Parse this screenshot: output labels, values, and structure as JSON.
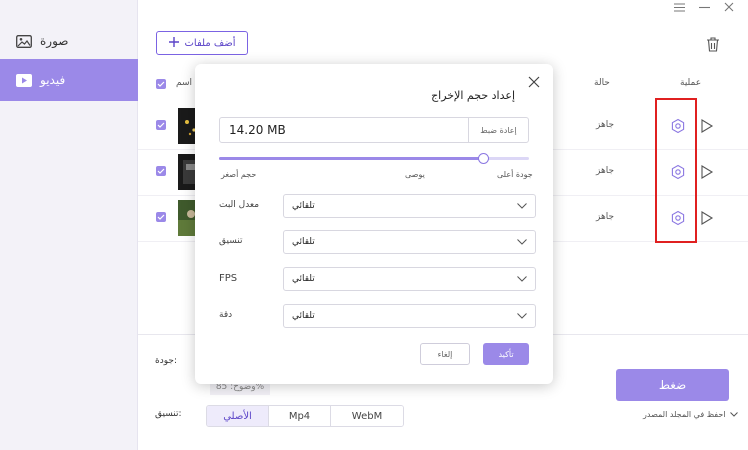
{
  "sidebar": {
    "items": [
      {
        "label": "صورة",
        "icon": "image-icon"
      },
      {
        "label": "فيديو",
        "icon": "video-icon",
        "active": true
      }
    ]
  },
  "window_controls": [
    "menu-icon",
    "minimize-icon",
    "close-icon"
  ],
  "toolbar": {
    "add_files_label": "أضف ملفات"
  },
  "table": {
    "headers": {
      "name": "اسم",
      "status": "حالة",
      "operation": "عملية"
    },
    "rows": [
      {
        "status": "جاهز",
        "checked": true
      },
      {
        "status": "جاهز",
        "checked": true
      },
      {
        "status": "جاهز",
        "checked": true
      }
    ]
  },
  "bottom": {
    "quality_label": "جودة:",
    "quality_chip": "وضوح: 85%",
    "format_label": "تنسيق:",
    "formats": [
      "الأصلي",
      "Mp4",
      "WebM"
    ],
    "active_format": "الأصلي",
    "compress_label": "ضغط",
    "save_to_label": "احفظ في المجلد المصدر"
  },
  "modal": {
    "title": "إعداد حجم الإخراج",
    "size_value": "14.20 MB",
    "reset_label": "إعادة ضبط",
    "slider": {
      "position": 0.85,
      "labels": {
        "small": "حجم أصغر",
        "recommended": "يوصى",
        "high": "جودة أعلى"
      }
    },
    "fields": [
      {
        "label": "معدل البت",
        "value": "تلقائي"
      },
      {
        "label": "تنسيق",
        "value": "تلقائي"
      },
      {
        "label": "FPS",
        "value": "تلقائي"
      },
      {
        "label": "دقة",
        "value": "تلقائي"
      }
    ],
    "cancel_label": "إلغاء",
    "ok_label": "تأكيد"
  },
  "colors": {
    "accent": "#9b89e8",
    "highlight": "#e02020"
  }
}
